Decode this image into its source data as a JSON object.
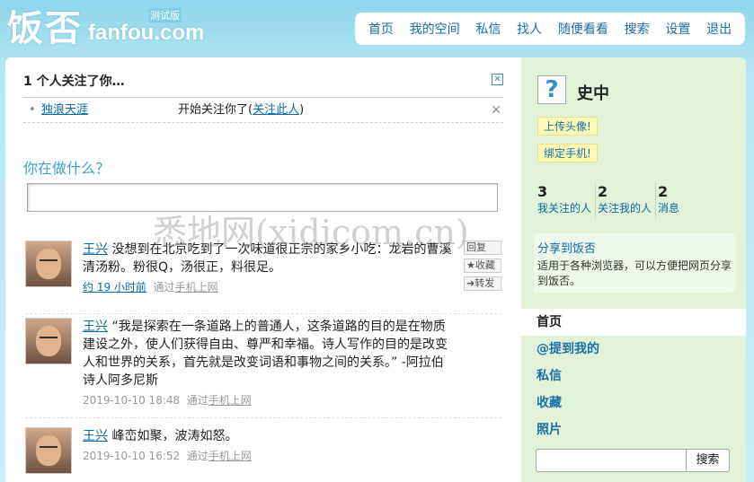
{
  "header": {
    "logo_cn": "饭否",
    "logo_en": "fanfou.com",
    "beta": "测试版",
    "nav": [
      "首页",
      "我的空间",
      "私信",
      "找人",
      "随便看看",
      "搜索",
      "设置",
      "退出"
    ]
  },
  "follow_notice": {
    "title": "1 个人关注了你…",
    "row": {
      "user": "独浪天涯",
      "msg_before": "开始关注你了(",
      "link": "关注此人",
      "msg_after": ")"
    }
  },
  "status_prompt": "你在做什么？",
  "tweets": [
    {
      "user": "王兴",
      "text": "没想到在北京吃到了一次味道很正宗的家乡小吃：龙岩的曹溪清汤粉。粉很Q，汤很正，料很足。",
      "time": "约 19 小时前",
      "via_prefix": "通过",
      "via": "手机上网",
      "actions": [
        "回复",
        "★收藏",
        "➜转发"
      ]
    },
    {
      "user": "王兴",
      "text": "“我是探索在一条道路上的普通人，这条道路的目的是在物质建设之外，使人们获得自由、尊严和幸福。诗人写作的目的是改变人和世界的关系，首先就是改变词语和事物之间的关系。” -阿拉伯诗人阿多尼斯",
      "time": "2019-10-10 18:48",
      "via_prefix": "通过",
      "via": "手机上网"
    },
    {
      "user": "王兴",
      "text": "峰峦如聚，波涛如怒。",
      "time": "2019-10-10 16:52",
      "via_prefix": "通过",
      "via": "手机上网"
    }
  ],
  "sidebar": {
    "avatar_icon": "?",
    "name": "史中",
    "upload_avatar": "上传头像!",
    "bind_phone": "绑定手机!",
    "stats": [
      {
        "num": "3",
        "label": "我关注的人"
      },
      {
        "num": "2",
        "label": "关注我的人"
      },
      {
        "num": "2",
        "label": "消息"
      }
    ],
    "share_title": "分享到饭否",
    "share_desc": "适用于各种浏览器，可以方便把网页分享到饭否。",
    "menu": [
      "首页",
      "@提到我的",
      "私信",
      "收藏",
      "照片"
    ],
    "search_button": "搜索"
  },
  "watermark": "悉地网(xidicom.cn)"
}
